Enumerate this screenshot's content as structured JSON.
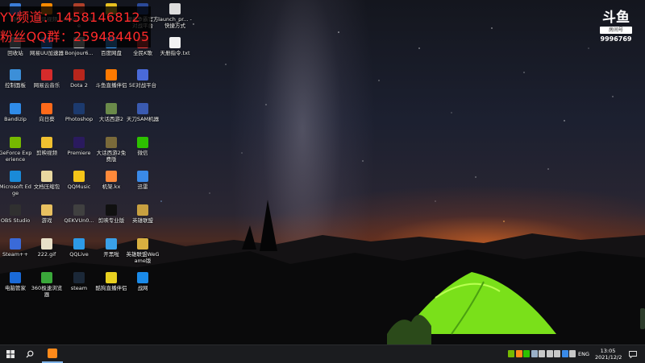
{
  "overlay": {
    "line1": "YY频道：1458146812",
    "line2": "粉丝QQ群：259484405"
  },
  "logo": {
    "mark": "斗鱼",
    "sub": "房间号",
    "room_id": "9996769"
  },
  "colors": {
    "overlay_text": "#ff2a2a",
    "taskbar": "#1b1c1f",
    "active_underline": "#7fb2e8"
  },
  "desktop_icons": [
    {
      "label": "网络",
      "icon": "network-icon",
      "color": "#3b7dd8"
    },
    {
      "label": "腾讯视频",
      "icon": "tencent-video-icon",
      "color": "#ff8a00"
    },
    {
      "label": "Albion Online",
      "icon": "albion-icon",
      "color": "#b0402a"
    },
    {
      "label": "YY",
      "icon": "yy-icon",
      "color": "#e8c020"
    },
    {
      "label": "魔兽争霸官方对战平台",
      "icon": "warcraft-icon",
      "color": "#2b4a9a"
    },
    {
      "label": "launch_pr... - 快捷方式",
      "icon": "shortcut-icon",
      "color": "#dcdcdc"
    },
    {
      "label": "天册指令.txt",
      "icon": "text-file-icon",
      "color": "#f2f2f2"
    },
    {
      "label": "回收站",
      "icon": "recycle-bin-icon",
      "color": "#9aa8b8"
    },
    {
      "label": "网易UU加速器",
      "icon": "uu-icon",
      "color": "#2d7be0"
    },
    {
      "label": "Bonjour6...",
      "icon": "bonjour-icon",
      "color": "#c0c0c0"
    },
    {
      "label": "百度网盘",
      "icon": "baidu-pan-icon",
      "color": "#3aa0ff"
    },
    {
      "label": "全民K歌",
      "icon": "kge-icon",
      "color": "#e83a3a"
    },
    {
      "label": "控制面板",
      "icon": "control-panel-icon",
      "color": "#3c8fd8"
    },
    {
      "label": "网易云音乐",
      "icon": "netease-music-icon",
      "color": "#d62b2b"
    },
    {
      "label": "Dota 2",
      "icon": "dota2-icon",
      "color": "#b8261c"
    },
    {
      "label": "斗鱼直播伴侣",
      "icon": "douyu-icon",
      "color": "#ff7a00"
    },
    {
      "label": "5E对战平台",
      "icon": "5e-icon",
      "color": "#4a6ad8"
    },
    {
      "label": "Bandizip",
      "icon": "bandizip-icon",
      "color": "#2f8be8"
    },
    {
      "label": "向日葵",
      "icon": "sunflower-icon",
      "color": "#ff6a1a"
    },
    {
      "label": "Photoshop",
      "icon": "photoshop-icon",
      "color": "#1c3a6e"
    },
    {
      "label": "大话西游2",
      "icon": "dahua2-icon",
      "color": "#6a8a4a"
    },
    {
      "label": "天刀SAM机器",
      "icon": "sam-icon",
      "color": "#3a5ab0"
    },
    {
      "label": "GeForce Experience",
      "icon": "geforce-icon",
      "color": "#76b900"
    },
    {
      "label": "剪映视频",
      "icon": "jianying-icon",
      "color": "#f0c030"
    },
    {
      "label": "Premiere",
      "icon": "premiere-icon",
      "color": "#2a1a5e"
    },
    {
      "label": "大话西游2免费版",
      "icon": "dahua2-free-icon",
      "color": "#7a6a3a"
    },
    {
      "label": "微信",
      "icon": "wechat-icon",
      "color": "#2dc100"
    },
    {
      "label": "Microsoft Edge",
      "icon": "edge-icon",
      "color": "#1a8ad8"
    },
    {
      "label": "文档压缩包",
      "icon": "archive-icon",
      "color": "#e8d8a0"
    },
    {
      "label": "QQMusic",
      "icon": "qqmusic-icon",
      "color": "#f5c518"
    },
    {
      "label": "机架.kx",
      "icon": "kx-icon",
      "color": "#ff8a3a"
    },
    {
      "label": "迅雷",
      "icon": "thunder-icon",
      "color": "#3a8ae8"
    },
    {
      "label": "OBS Studio",
      "icon": "obs-icon",
      "color": "#303030"
    },
    {
      "label": "游戏",
      "icon": "folder-icon",
      "color": "#e8c060"
    },
    {
      "label": "QEKVUn0...",
      "icon": "unknown-app-icon",
      "color": "#404040"
    },
    {
      "label": "剪映专业版",
      "icon": "jianying-pro-icon",
      "color": "#101010"
    },
    {
      "label": "英雄联盟",
      "icon": "lol-icon",
      "color": "#c8a040"
    },
    {
      "label": "Steam++",
      "icon": "steam-plus-icon",
      "color": "#3a6ad8"
    },
    {
      "label": "222.gif",
      "icon": "gif-file-icon",
      "color": "#e8e0c8"
    },
    {
      "label": "QQLive",
      "icon": "qqlive-icon",
      "color": "#2d9ae8"
    },
    {
      "label": "开黑啦",
      "icon": "kaiheila-icon",
      "color": "#3aa0e8"
    },
    {
      "label": "英雄联盟WeGame版",
      "icon": "lol-wegame-icon",
      "color": "#d8b040"
    },
    {
      "label": "电脑管家",
      "icon": "pc-manager-icon",
      "color": "#1a6ad8"
    },
    {
      "label": "360极速浏览器",
      "icon": "360-browser-icon",
      "color": "#3aa83a"
    },
    {
      "label": "steam",
      "icon": "steam-icon",
      "color": "#1b2838"
    },
    {
      "label": "酷狗直播伴侣",
      "icon": "kugou-live-icon",
      "color": "#e8d020"
    },
    {
      "label": "战网",
      "icon": "battlenet-icon",
      "color": "#1a8ae8"
    }
  ],
  "taskbar": {
    "start_icon": "windows-start-icon",
    "search_icon": "search-icon",
    "pinned_app_icon": "douyu-taskbar-icon",
    "language": "ENG",
    "time": "13:05",
    "date": "2021/12/2",
    "tray_icons": [
      "nvidia-tray-icon",
      "douyu-tray-icon",
      "wechat-tray-icon",
      "network-tray-icon",
      "microphone-tray-icon",
      "volume-tray-icon",
      "display-tray-icon",
      "security-tray-icon",
      "speaker-tray-icon"
    ],
    "notification_icon": "notification-icon"
  }
}
